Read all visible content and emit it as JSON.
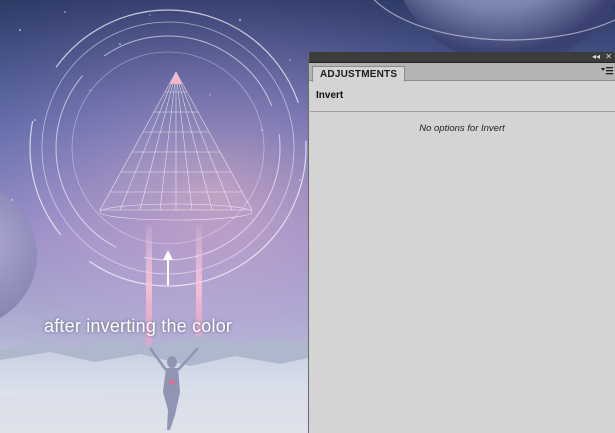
{
  "scene": {
    "caption": "after inverting the color"
  },
  "panel": {
    "tab_label": "ADJUSTMENTS",
    "adjustment_name": "Invert",
    "message": "No options for Invert",
    "titlebar_icons": [
      "collapse-icon",
      "close-icon"
    ],
    "menu_icon": "panel-menu-icon"
  }
}
